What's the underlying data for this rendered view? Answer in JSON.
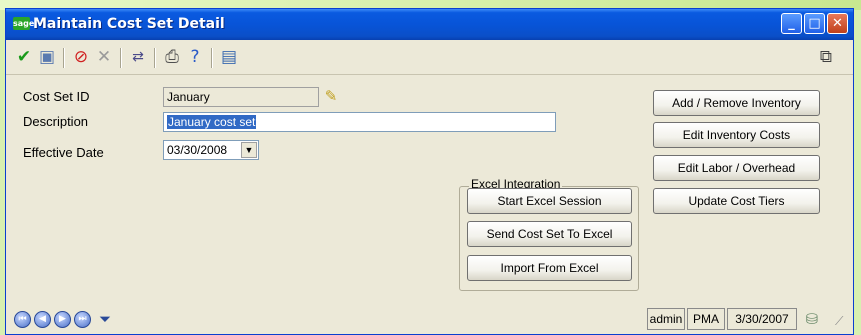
{
  "window": {
    "title": "Maintain Cost Set Detail",
    "logo": "sage",
    "controls": [
      "minimize",
      "maximize",
      "close"
    ]
  },
  "toolbar": {
    "icons": [
      "checkmark-icon",
      "save-icon",
      "stop-icon",
      "delete-x-icon",
      "find-replace-icon",
      "print-icon",
      "help-icon",
      "properties-icon",
      "screen-icon"
    ]
  },
  "form": {
    "cost_set_id_label": "Cost Set ID",
    "cost_set_id_value": "January",
    "description_label": "Description",
    "description_value": "January cost set",
    "effective_date_label": "Effective Date",
    "effective_date_value": "03/30/2008"
  },
  "excel": {
    "title": "Excel Integration",
    "start": "Start Excel Session",
    "send": "Send Cost Set To Excel",
    "import": "Import From Excel"
  },
  "actions": {
    "add_remove": "Add / Remove Inventory",
    "edit_inventory": "Edit Inventory Costs",
    "edit_labor": "Edit Labor / Overhead",
    "update_tiers": "Update Cost Tiers"
  },
  "status": {
    "user": "admin",
    "company": "PMA",
    "date": "3/30/2007"
  },
  "colors": {
    "title_bar": "#0854d8",
    "selection": "#316ac5",
    "background": "#ece9d8"
  }
}
